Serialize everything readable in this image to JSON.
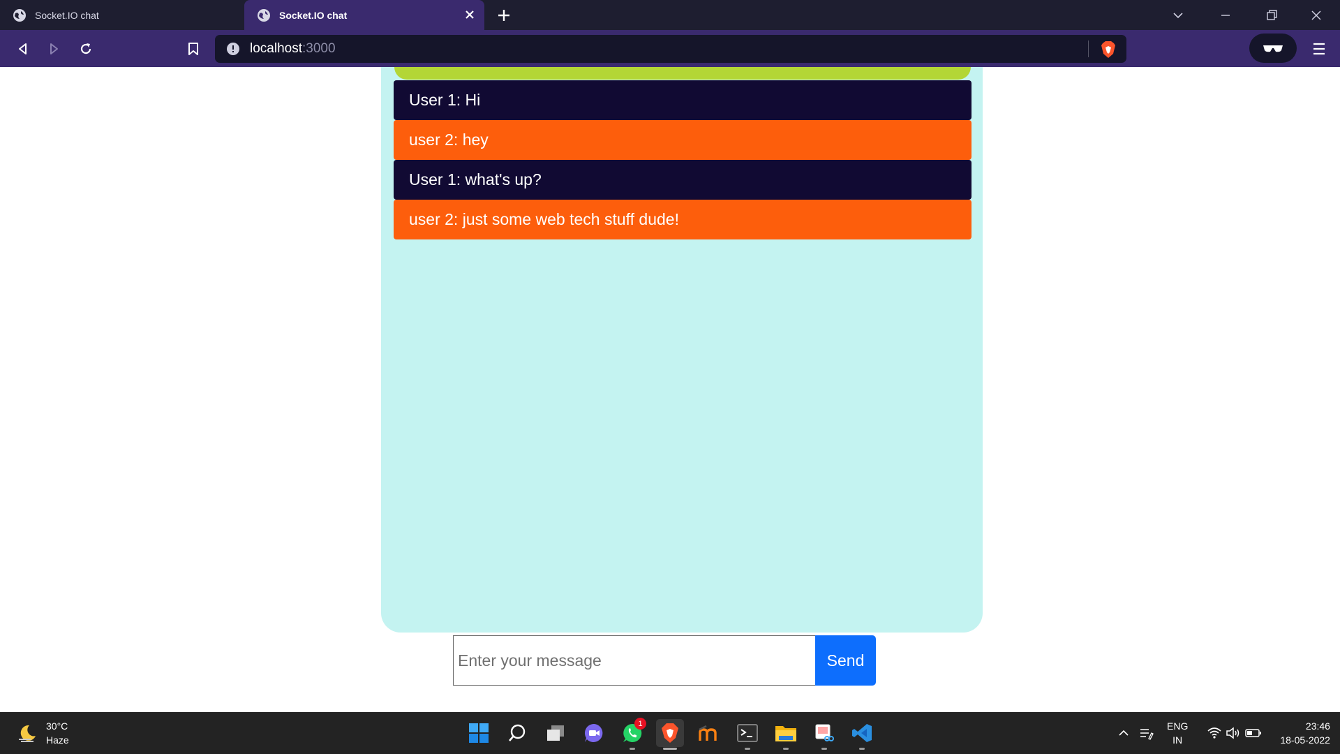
{
  "browser": {
    "tabs": [
      {
        "title": "Socket.IO chat",
        "active": false
      },
      {
        "title": "Socket.IO chat",
        "active": true
      }
    ],
    "url": {
      "host": "localhost",
      "port": ":3000"
    }
  },
  "chat": {
    "messages": [
      {
        "text": "User 1: Hi",
        "sender": "user1"
      },
      {
        "text": "user 2: hey",
        "sender": "user2"
      },
      {
        "text": "User 1: what's up?",
        "sender": "user1"
      },
      {
        "text": "user 2: just some web tech stuff dude!",
        "sender": "user2"
      }
    ],
    "input_placeholder": "Enter your message",
    "send_label": "Send",
    "colors": {
      "user1": "#110a33",
      "user2": "#fd5e0c",
      "panel": "#c4f3f1",
      "accent_strip": "#b3d636",
      "send": "#0d6efd"
    }
  },
  "taskbar": {
    "weather": {
      "temp": "30°C",
      "condition": "Haze"
    },
    "apps": [
      "windows-start",
      "search",
      "task-view",
      "meet-chat",
      "whatsapp",
      "brave",
      "moodle",
      "terminal",
      "file-explorer",
      "snipping-tool",
      "vscode"
    ],
    "whatsapp_badge": "1",
    "language": {
      "line1": "ENG",
      "line2": "IN"
    },
    "clock": {
      "time": "23:46",
      "date": "18-05-2022"
    }
  }
}
